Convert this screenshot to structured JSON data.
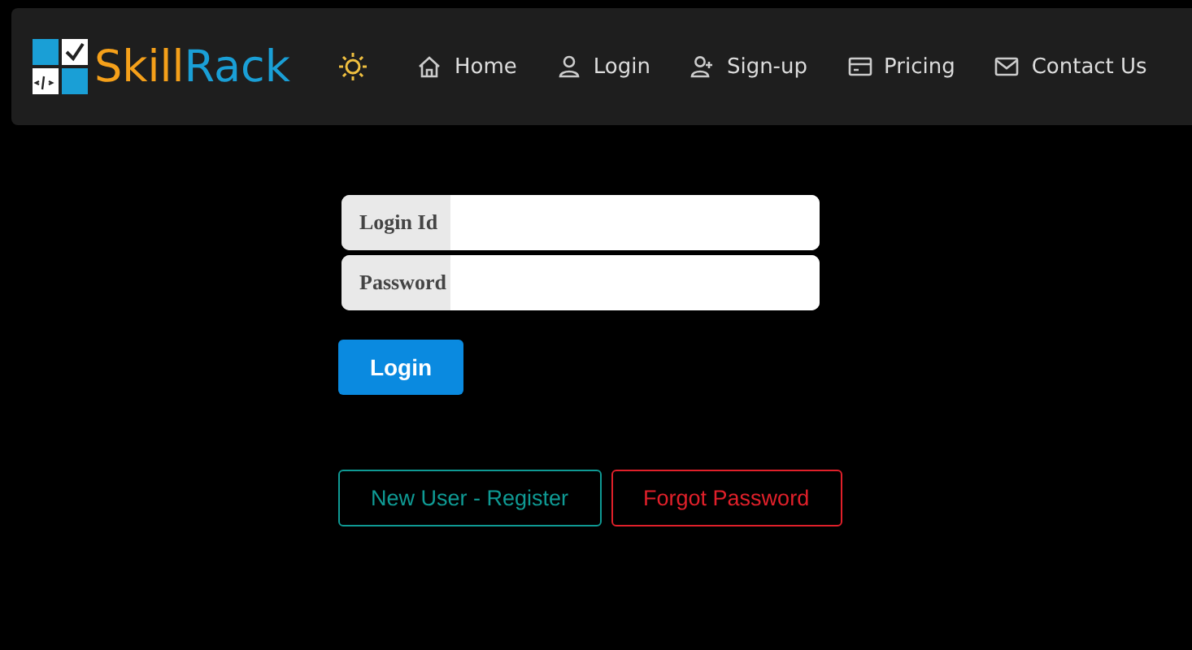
{
  "brand": {
    "first": "Skill",
    "second": "Rack"
  },
  "nav": [
    {
      "kind": "home",
      "label": "Home"
    },
    {
      "kind": "user",
      "label": "Login"
    },
    {
      "kind": "user-plus",
      "label": "Sign-up"
    },
    {
      "kind": "card",
      "label": "Pricing"
    },
    {
      "kind": "mail",
      "label": "Contact Us"
    }
  ],
  "form": {
    "fields": [
      {
        "label": "Login Id"
      },
      {
        "label": "Password"
      }
    ],
    "submit": "Login"
  },
  "links": [
    {
      "label": "New User - Register",
      "color": "#0f9a94"
    },
    {
      "label": "Forgot Password",
      "color": "#e0202a"
    }
  ]
}
